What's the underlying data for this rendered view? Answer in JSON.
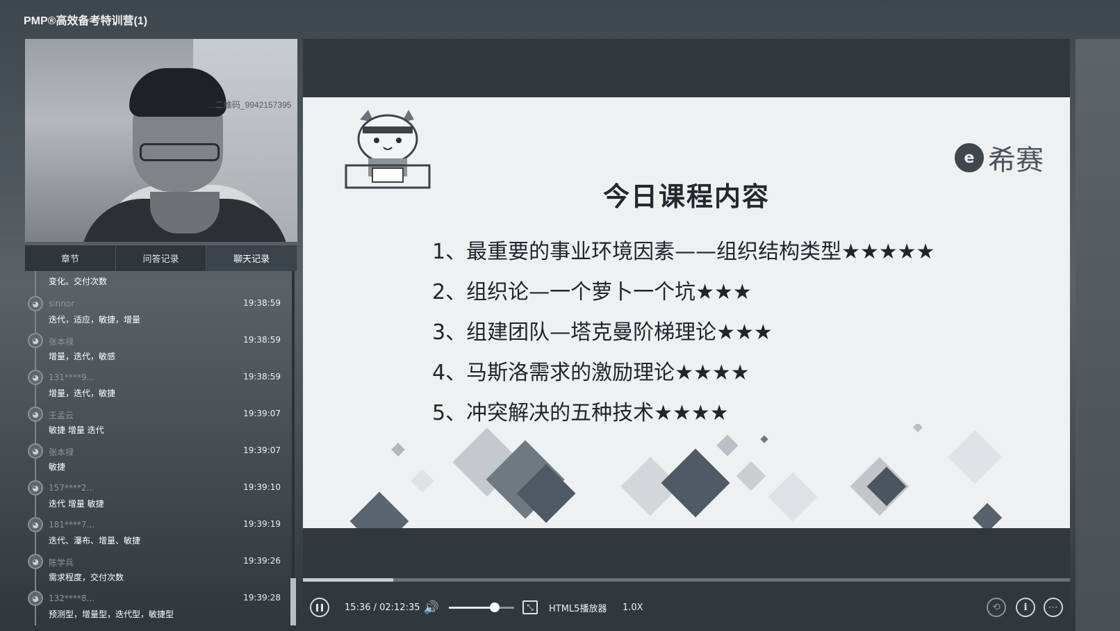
{
  "window": {
    "title": "PMP®高效备考特训营(1)"
  },
  "webcam": {
    "watermark": "...二维码_9942157395"
  },
  "tabs": [
    {
      "label": "章节"
    },
    {
      "label": "问答记录"
    },
    {
      "label": "聊天记录",
      "active": true
    }
  ],
  "chat": {
    "first_text": "变化。交付次数",
    "messages": [
      {
        "user": "sinnor",
        "time": "19:38:59",
        "text": "迭代，适应，敏捷，增量"
      },
      {
        "user": "张本禄",
        "time": "19:38:59",
        "text": "增量，迭代，敏感"
      },
      {
        "user": "131****9...",
        "time": "19:38:59",
        "text": "增量，迭代，敏捷"
      },
      {
        "user": "王孟云",
        "time": "19:39:07",
        "text": "敏捷 增量 迭代"
      },
      {
        "user": "张本禄",
        "time": "19:39:07",
        "text": "敏捷"
      },
      {
        "user": "157****2...",
        "time": "19:39:10",
        "text": "迭代 增量 敏捷"
      },
      {
        "user": "181****7...",
        "time": "19:39:19",
        "text": "迭代、瀑布、增量、敏捷"
      },
      {
        "user": "陈学兵",
        "time": "19:39:26",
        "text": "需求程度，交付次数"
      },
      {
        "user": "132****8...",
        "time": "19:39:28",
        "text": "预测型，增量型，迭代型，敏捷型"
      }
    ]
  },
  "slide": {
    "brand": "希赛",
    "brand_logo": "e",
    "title": "今日课程内容",
    "items": [
      "1、最重要的事业环境因素——组织结构类型★★★★★",
      "2、组织论—一个萝卜一个坑★★★",
      "3、组建团队—塔克曼阶梯理论★★★",
      "4、马斯洛需求的激励理论★★★★",
      "5、冲突解决的五种技术★★★★"
    ]
  },
  "player": {
    "time": "15:36 / 02:12:35",
    "progress": 0.118,
    "volume": 0.7,
    "name": "HTML5播放器",
    "speed": "1.0X",
    "icons": {
      "pause": "pause-icon",
      "volume": "volume-icon",
      "fit": "fit-screen-icon",
      "share": "share-icon",
      "info": "info-icon",
      "more": "more-icon"
    }
  },
  "colors": {
    "background": "#4a5259",
    "slide": "#eef0f2",
    "text_dark": "#1f252a"
  }
}
